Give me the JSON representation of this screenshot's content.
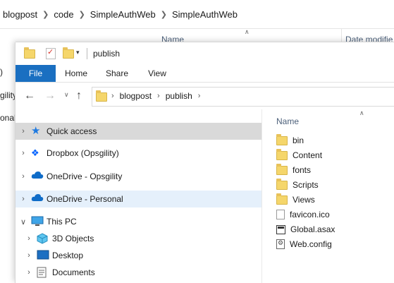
{
  "background_window": {
    "breadcrumb": [
      "blogpost",
      "code",
      "SimpleAuthWeb",
      "SimpleAuthWeb"
    ],
    "columns": {
      "name": "Name",
      "date_modified": "Date modifie"
    },
    "left_fragments": [
      ")",
      "gility",
      "onal"
    ]
  },
  "front_window": {
    "quick_access_toolbar": {
      "icons": [
        "folder-icon",
        "properties-icon",
        "new-folder-icon",
        "customize-dropdown-icon"
      ]
    },
    "title": "publish",
    "ribbon_tabs": [
      "File",
      "Home",
      "Share",
      "View"
    ],
    "active_tab": "File",
    "address": {
      "path": [
        "blogpost",
        "publish"
      ]
    },
    "navigation": {
      "quick_access": "Quick access",
      "dropbox": "Dropbox (Opsgility)",
      "onedrive_opsgility": "OneDrive - Opsgility",
      "onedrive_personal": "OneDrive - Personal",
      "this_pc": "This PC",
      "objects_3d": "3D Objects",
      "desktop": "Desktop",
      "documents": "Documents"
    },
    "file_list": {
      "header_name": "Name",
      "folders": [
        "bin",
        "Content",
        "fonts",
        "Scripts",
        "Views"
      ],
      "files": [
        {
          "name": "favicon.ico",
          "icon": "favicon-file-icon"
        },
        {
          "name": "Global.asax",
          "icon": "asax-file-icon"
        },
        {
          "name": "Web.config",
          "icon": "config-file-icon"
        }
      ]
    }
  },
  "colors": {
    "file_tab": "#1a6fc1",
    "folder": "#f5d66b",
    "selected_nav": "#d9d9d9",
    "hover_nav": "#e5f0fb",
    "column_header": "#4c607a"
  }
}
